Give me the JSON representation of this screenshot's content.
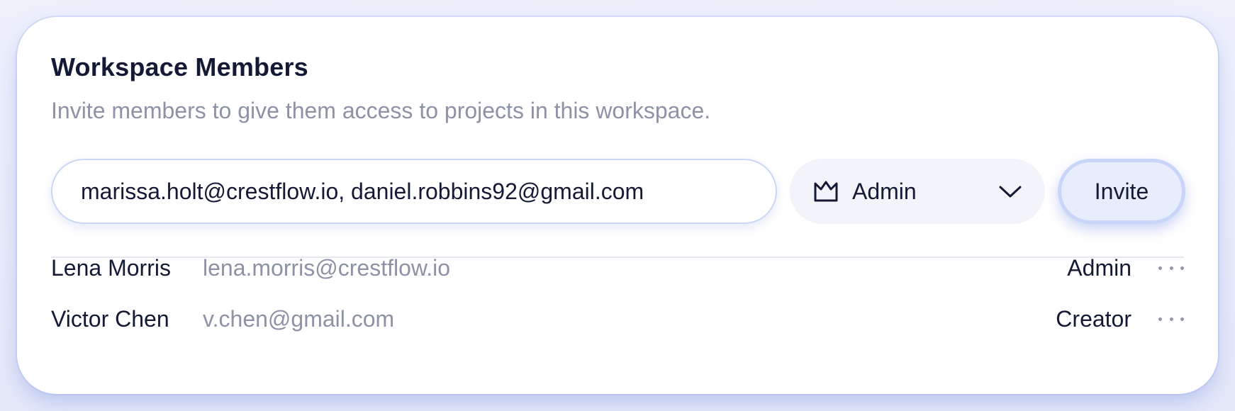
{
  "card": {
    "title": "Workspace Members",
    "subtitle": "Invite members to give them access to projects in this workspace."
  },
  "invite_form": {
    "emails_value": "marissa.holt@crestflow.io, daniel.robbins92@gmail.com",
    "role_icon": "crown-icon",
    "role_selected": "Admin",
    "dropdown_icon": "chevron-down-icon",
    "invite_label": "Invite"
  },
  "members": [
    {
      "name": "Lena Morris",
      "email": "lena.morris@crestflow.io",
      "role": "Admin"
    },
    {
      "name": "Victor Chen",
      "email": "v.chen@gmail.com",
      "role": "Creator"
    }
  ],
  "colors": {
    "text_primary": "#141a35",
    "text_muted": "#8d92a6",
    "accent_border": "#c9d6f7",
    "button_bg": "#e8edfc"
  }
}
